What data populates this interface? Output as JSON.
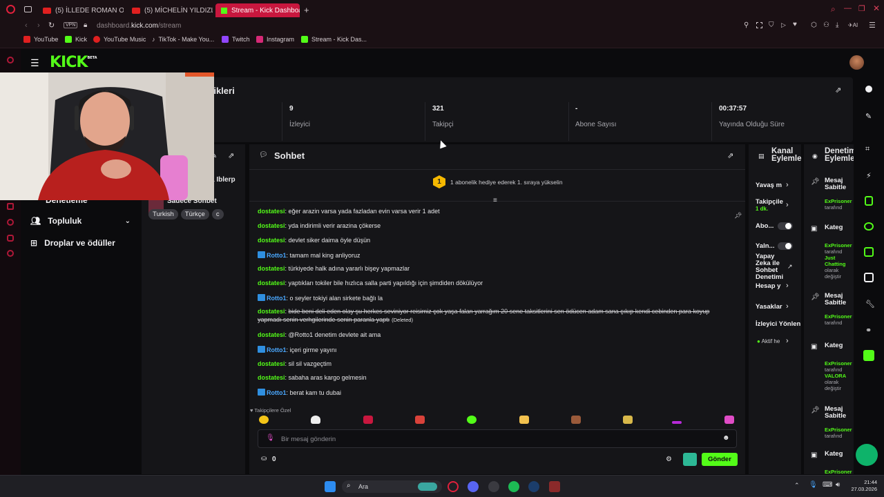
{
  "browser": {
    "tabs": [
      {
        "title": "(5) İLLEDE ROMAN OLSUN...",
        "type": "youtube"
      },
      {
        "title": "(5) MİCHELİN YILDIZLI SO...",
        "type": "youtube"
      },
      {
        "title": "Stream - Kick Dashboard",
        "type": "kick"
      }
    ],
    "vpn_label": "VPN",
    "url_host": "dashboard.",
    "url_domain": "kick.com",
    "url_path": "/stream",
    "ai_label": "AI",
    "bookmarks": [
      "YouTube",
      "Kick",
      "YouTube Music",
      "TikTok - Make You...",
      "Twitch",
      "Instagram",
      "Stream - Kick Das..."
    ]
  },
  "nav": {
    "logo": "KICK",
    "logo_badge": "BETA"
  },
  "sidebar": {
    "items": [
      {
        "label": "Denetleme"
      },
      {
        "label": "Topluluk"
      },
      {
        "label": "Droplar ve ödüller"
      }
    ]
  },
  "stats": {
    "title": "tikleri",
    "items": [
      {
        "value": "9",
        "label": "İzleyici"
      },
      {
        "value": "321",
        "label": "Takipçi"
      },
      {
        "value": "-",
        "label": "Abone Sayısı"
      },
      {
        "value": "00:37:57",
        "label": "Yayında Olduğu Süre"
      }
    ]
  },
  "stream_info": {
    "title_fragment": "a Iblerp",
    "category": "Sadece Sohbet",
    "tags": [
      "Turkish",
      "Türkçe",
      "c"
    ]
  },
  "chat": {
    "title": "Sohbet",
    "gift_rank": "1",
    "gift_text": "1 abonelik hediye ederek 1. sıraya yükselin",
    "messages": [
      {
        "user": "dostatesi",
        "text": "eğer arazin varsa yada fazladan evin varsa verir 1 adet",
        "style": "u"
      },
      {
        "user": "dostatesi",
        "text": "yda indirimli verir arazina çökerse",
        "style": "u"
      },
      {
        "user": "dostatesi",
        "text": "devlet siker daima öyle düşün",
        "style": "u"
      },
      {
        "user": "Rotto1",
        "text": "tamam mal king anliyoruz",
        "style": "u2"
      },
      {
        "user": "dostatesi",
        "text": "türkiyede halk adına yararlı bişey yapmazlar",
        "style": "u"
      },
      {
        "user": "dostatesi",
        "text": "yaptıkları tokiler bile hızlıca salla parti yapıldığı için şimdiden dökülüyor",
        "style": "u"
      },
      {
        "user": "Rotto1",
        "text": "o seyler tokiyi alan sirkete bağlı la",
        "style": "u2"
      },
      {
        "user": "dostatesi",
        "text": "bide beni deli eden olay şu herkes seviniyor reisimiz çok yaşa falan yarrağım 20 sene taksitlerini sen ödücen adam sana çıkıp kendi cebinden para koyup",
        "style": "u",
        "deleted": true
      },
      {
        "user": "dostatesi",
        "text": "@Rotto1 denetim devlete ait ama",
        "style": "u"
      },
      {
        "user": "Rotto1",
        "text": "içeri girme yayını",
        "style": "u2"
      },
      {
        "user": "dostatesi",
        "text": "sil sil vazgeçtim",
        "style": "u"
      },
      {
        "user": "dostatesi",
        "text": "sabaha aras kargo gelmesin",
        "style": "u"
      },
      {
        "user": "Rotto1",
        "text": "berat kam tu dubai",
        "style": "u2"
      }
    ],
    "deleted_line2": "yapmadı senin verhgilerinde senin paranla yaptı",
    "deleted_tag": "(Deleted)",
    "followers_only": "Takipçilere Özel",
    "input_placeholder": "Bir mesaj gönderin",
    "points": "0",
    "send_label": "Gönder"
  },
  "actions": {
    "title_line1": "Kanal",
    "title_line2": "Eylemle",
    "items": [
      {
        "label": "Yavaş m"
      },
      {
        "label": "Takipçile",
        "sub": "1 dk."
      },
      {
        "label": "Abo..."
      },
      {
        "label": "Yaln..."
      },
      {
        "label": "Yapay Zeka ile Sohbet Denetimi"
      },
      {
        "label": "Hesap y"
      },
      {
        "label": "Yasaklar"
      },
      {
        "label": "İzleyici Yönlen"
      },
      {
        "label": "Aktif he"
      }
    ]
  },
  "modlog": {
    "title_line1": "Denetim",
    "title_line2": "Eylemle",
    "entries": [
      {
        "head": "Mesaj Sabitle",
        "user": "ExPrisoner",
        "text": "tarafınd"
      },
      {
        "head": "Kateg",
        "user": "ExPrisoner",
        "text": "tarafınd",
        "cat": "Just Chatting",
        "tail": "olarak değiştir"
      },
      {
        "head": "Mesaj Sabitle",
        "user": "ExPrisoner",
        "text": "tarafınd"
      },
      {
        "head": "Kateg",
        "user": "ExPrisoner",
        "text": "tarafınd",
        "cat": "VALORA",
        "tail": "olarak değiştir"
      },
      {
        "head": "Mesaj Sabitle",
        "user": "ExPrisoner",
        "text": "tarafınd"
      },
      {
        "head": "Kateg",
        "user": "ExPrisoner",
        "text": ""
      }
    ]
  },
  "taskbar": {
    "search": "Ara",
    "time": "21:44",
    "date": "27.03.2026"
  },
  "colors": {
    "accent": "#53fc18",
    "browser_tab_active": "#c8173e",
    "panel": "#151518"
  }
}
